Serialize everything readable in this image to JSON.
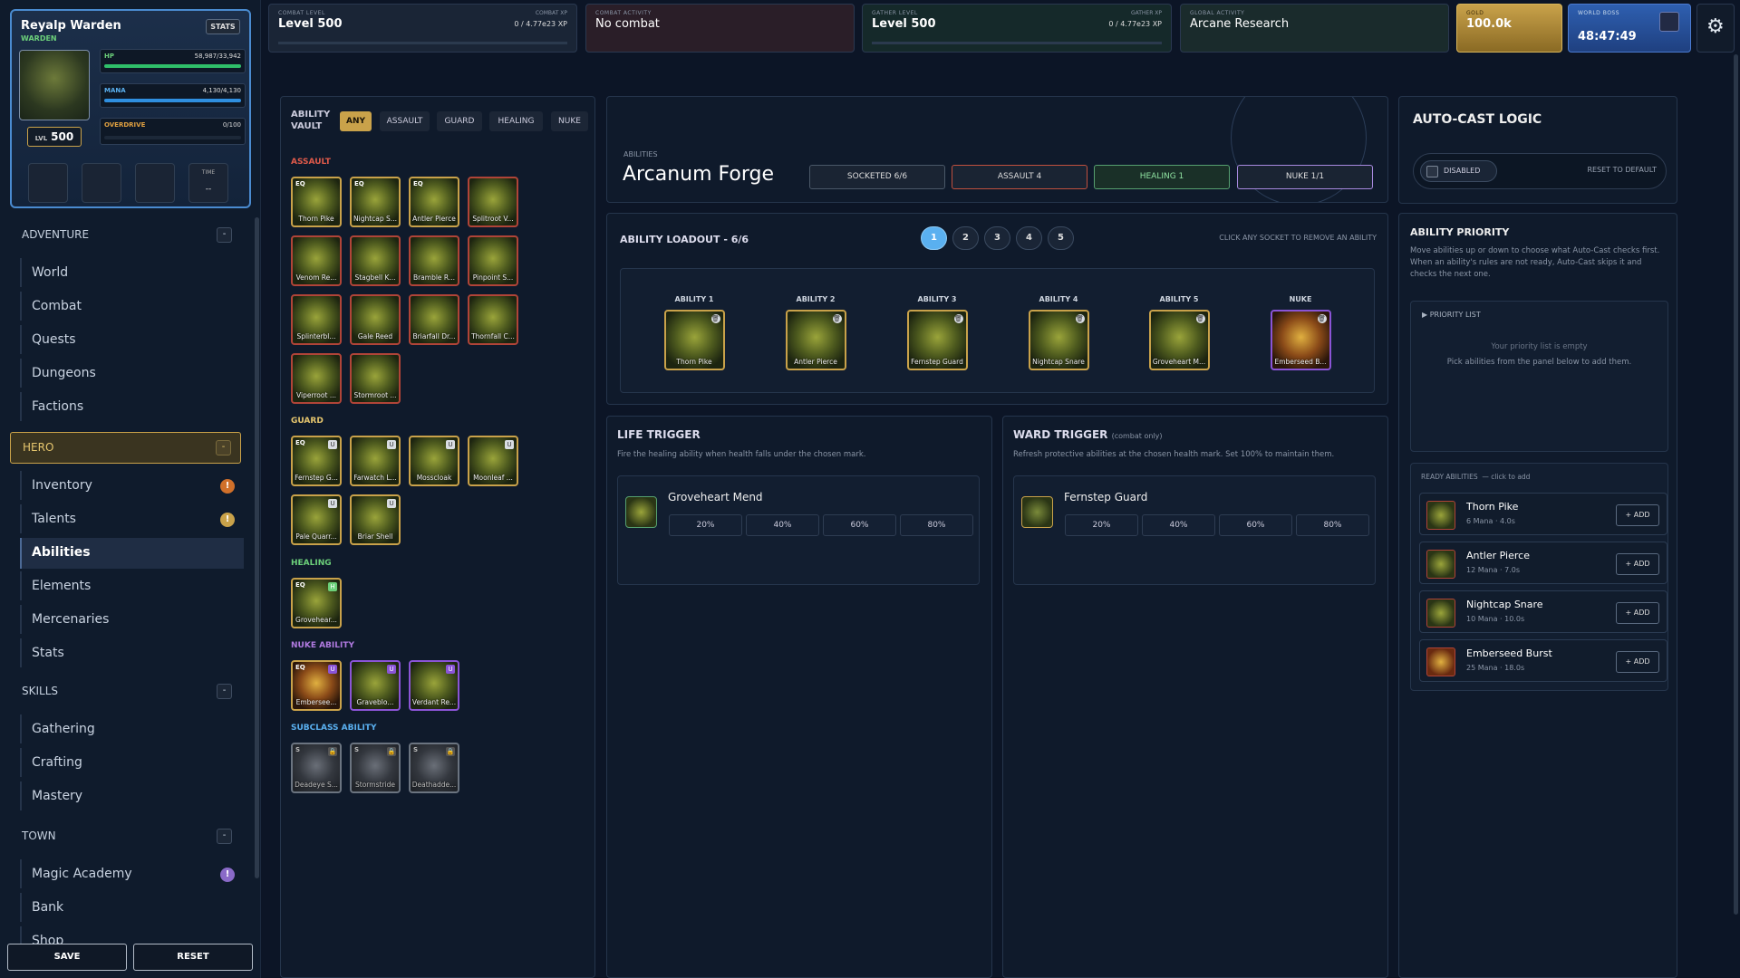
{
  "hero": {
    "name": "Reyalp Warden",
    "class": "WARDEN",
    "stats_btn": "STATS",
    "lvl_prefix": "LVL",
    "level": "500",
    "hp_label": "HP",
    "hp_value": "58,987/33,942",
    "mana_label": "MANA",
    "mana_value": "4,130/4,130",
    "overdrive_label": "OVERDRIVE",
    "overdrive_value": "0/100",
    "time_label": "TIME",
    "time_value": "--"
  },
  "nav": {
    "adventure": {
      "title": "ADVENTURE",
      "items": [
        "World",
        "Combat",
        "Quests",
        "Dungeons",
        "Factions"
      ]
    },
    "hero": {
      "title": "HERO",
      "items": [
        "Inventory",
        "Talents",
        "Abilities",
        "Elements",
        "Mercenaries",
        "Stats"
      ]
    },
    "skills": {
      "title": "SKILLS",
      "items": [
        "Gathering",
        "Crafting",
        "Mastery"
      ]
    },
    "town": {
      "title": "TOWN",
      "items": [
        "Magic Academy",
        "Bank",
        "Shop"
      ]
    },
    "collapse": "-",
    "badge": "!",
    "save": "SAVE",
    "reset": "RESET"
  },
  "topbar": {
    "combat_level_label": "COMBAT LEVEL",
    "combat_level": "Level 500",
    "combat_xp_label": "COMBAT XP",
    "combat_xp": "0 / 4.77e23 XP",
    "combat_activity_label": "COMBAT ACTIVITY",
    "combat_activity": "No combat",
    "gather_level_label": "GATHER LEVEL",
    "gather_level": "Level 500",
    "gather_xp_label": "GATHER XP",
    "gather_xp": "0 / 4.77e23 XP",
    "global_activity_label": "GLOBAL ACTIVITY",
    "global_activity": "Arcane Research",
    "gold_label": "GOLD",
    "gold": "100.0k",
    "boss_label": "WORLD BOSS",
    "boss_timer": "48:47:49"
  },
  "vault": {
    "title_1": "ABILITY",
    "title_2": "VAULT",
    "tabs": [
      "ANY",
      "ASSAULT",
      "GUARD",
      "HEALING",
      "NUKE"
    ],
    "assault_label": "ASSAULT",
    "guard_label": "GUARD",
    "healing_label": "HEALING",
    "nuke_label": "NUKE ABILITY",
    "subclass_label": "SUBCLASS ABILITY",
    "assault": [
      "Thorn Pike",
      "Nightcap S...",
      "Antler Pierce",
      "Splitroot V...",
      "Venom Re...",
      "Stagbell K...",
      "Bramble R...",
      "Pinpoint S...",
      "Splinterbl...",
      "Gale Reed",
      "Briarfall Dr...",
      "Thornfall C...",
      "Viperroot ...",
      "Stormroot ..."
    ],
    "guard": [
      "Fernstep G...",
      "Farwatch L...",
      "Mosscloak",
      "Moonleaf ...",
      "Pale Quarr...",
      "Briar Shell"
    ],
    "healing": [
      "Grovehear..."
    ],
    "nuke": [
      "Embersee...",
      "Graveblo...",
      "Verdant Re..."
    ],
    "subclass": [
      "Deadeye S...",
      "Stormstride",
      "Deathadde..."
    ],
    "eq": "EQ",
    "lock": "U",
    "heal_tag": "H",
    "sub_tag": "S"
  },
  "forge": {
    "caption": "ABILITIES",
    "title": "Arcanum Forge",
    "socketed": "SOCKETED 6/6",
    "assault": "ASSAULT 4",
    "healing": "HEALING 1",
    "nuke": "NUKE 1/1"
  },
  "loadout": {
    "title": "ABILITY LOADOUT - 6/6",
    "numbers": [
      "1",
      "2",
      "3",
      "4",
      "5"
    ],
    "hint": "CLICK ANY SOCKET TO REMOVE AN ABILITY",
    "slots": [
      {
        "label": "ABILITY 1",
        "name": "Thorn Pike"
      },
      {
        "label": "ABILITY 2",
        "name": "Antler Pierce"
      },
      {
        "label": "ABILITY 3",
        "name": "Fernstep Guard"
      },
      {
        "label": "ABILITY 4",
        "name": "Nightcap Snare"
      },
      {
        "label": "ABILITY 5",
        "name": "Groveheart M..."
      },
      {
        "label": "NUKE",
        "name": "Emberseed B..."
      }
    ]
  },
  "life": {
    "title": "LIFE TRIGGER",
    "desc": "Fire the healing ability when health falls under the chosen mark.",
    "ability": "Groveheart Mend",
    "pcts": [
      "20%",
      "40%",
      "60%",
      "80%"
    ]
  },
  "ward": {
    "title": "WARD TRIGGER",
    "note": "(combat only)",
    "desc": "Refresh protective abilities at the chosen health mark. Set 100% to maintain them.",
    "ability": "Fernstep Guard",
    "pcts": [
      "20%",
      "40%",
      "60%",
      "80%"
    ]
  },
  "autocast": {
    "title": "AUTO-CAST LOGIC",
    "toggle": "DISABLED",
    "reset": "RESET TO DEFAULT",
    "prio_title": "ABILITY PRIORITY",
    "prio_desc": "Move abilities up or down to choose what Auto-Cast checks first. When an ability's rules are not ready, Auto-Cast skips it and checks the next one.",
    "list_label": "PRIORITY LIST",
    "empty1": "Your priority list is empty",
    "empty2": "Pick abilities from the panel below to add them.",
    "ready_label": "READY ABILITIES",
    "ready_hint": "— click to add",
    "add": "+ ADD",
    "ready": [
      {
        "name": "Thorn Pike",
        "stats": "6 Mana · 4.0s"
      },
      {
        "name": "Antler Pierce",
        "stats": "12 Mana · 7.0s"
      },
      {
        "name": "Nightcap Snare",
        "stats": "10 Mana · 10.0s"
      },
      {
        "name": "Emberseed Burst",
        "stats": "25 Mana · 18.0s"
      }
    ]
  },
  "colors": {
    "gold": "#c9a24a",
    "assault": "#b04438",
    "guard": "#c9a24a",
    "healing": "#6cd07a",
    "nuke": "#8a54d6"
  }
}
